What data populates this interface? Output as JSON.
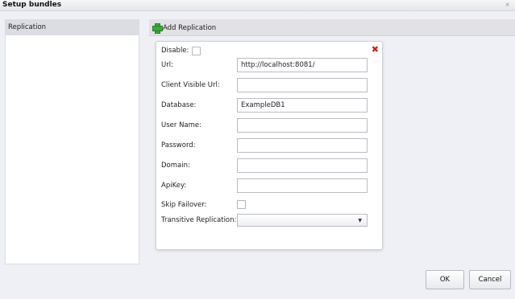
{
  "window": {
    "title": "Setup bundles",
    "close_glyph": "×"
  },
  "sidebar": {
    "items": [
      {
        "label": "Replication"
      }
    ]
  },
  "toolbar": {
    "add_label": "Add Replication",
    "add_icon": "plus-icon"
  },
  "form": {
    "disable_label": "Disable:",
    "url_label": "Url:",
    "url_value": "http://localhost:8081/",
    "client_url_label": "Client Visible Url:",
    "client_url_value": "",
    "database_label": "Database:",
    "database_value": "ExampleDB1",
    "username_label": "User Name:",
    "username_value": "",
    "password_label": "Password:",
    "password_value": "",
    "domain_label": "Domain:",
    "domain_value": "",
    "apikey_label": "ApiKey:",
    "apikey_value": "",
    "skip_failover_label": "Skip Failover:",
    "transitive_label": "Transitive Replication:",
    "transitive_value": "",
    "remove_glyph": "✖",
    "dropdown_glyph": "▼"
  },
  "footer": {
    "ok_label": "OK",
    "cancel_label": "Cancel"
  },
  "colors": {
    "add_icon": "#3fa83a",
    "remove_icon": "#d11a1a",
    "sidebar_selected": "#dcdde2"
  }
}
